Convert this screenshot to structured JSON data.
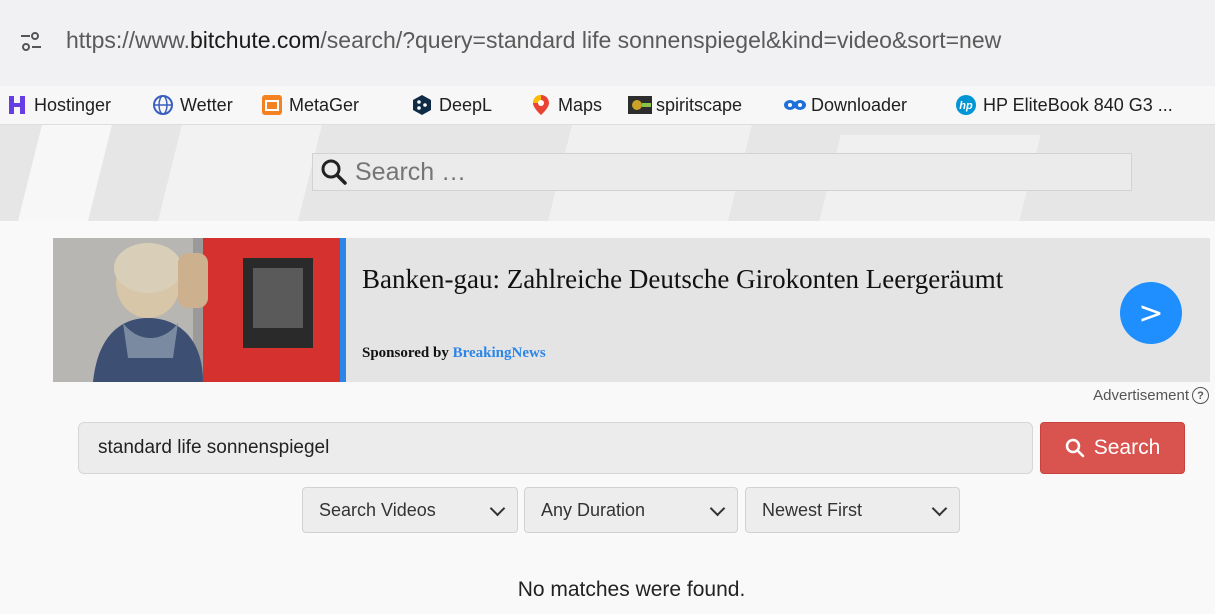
{
  "browser": {
    "url_prefix": "https://www.",
    "url_domain": "bitchute.com",
    "url_rest": "/search/?query=standard life sonnenspiegel&kind=video&sort=new"
  },
  "bookmarks": [
    {
      "label": "Hostinger",
      "icon": "hostinger-icon",
      "color": "#673de6"
    },
    {
      "label": "Wetter",
      "icon": "globe-icon",
      "color": "#3b5fc0"
    },
    {
      "label": "MetaGer",
      "icon": "metager-icon",
      "color": "#f58220"
    },
    {
      "label": "DeepL",
      "icon": "deepl-icon",
      "color": "#0f2b46"
    },
    {
      "label": "Maps",
      "icon": "map-pin-icon",
      "color": "#34a853"
    },
    {
      "label": "spiritscape",
      "icon": "spiritscape-icon",
      "color": "#c9a227"
    },
    {
      "label": "Downloader",
      "icon": "downloader-icon",
      "color": "#1e6fd9"
    },
    {
      "label": "HP EliteBook 840 G3 ...",
      "icon": "hp-icon",
      "color": "#0096d6"
    }
  ],
  "header": {
    "search_placeholder": "Search …"
  },
  "ad": {
    "title": "Banken-gau: Zahlreiche Deutsche Girokonten Leergeräumt",
    "sponsored_prefix": "Sponsored by ",
    "sponsor": "BreakingNews",
    "arrow": ">",
    "label": "Advertisement",
    "help": "?"
  },
  "search": {
    "query": "standard life sonnenspiegel",
    "button_label": "Search",
    "kind_selected": "Search Videos",
    "duration_selected": "Any Duration",
    "sort_selected": "Newest First"
  },
  "results": {
    "message": "No matches were found."
  },
  "colors": {
    "search_button": "#d9534f",
    "ad_accent": "#2b86e8",
    "ad_arrow": "#1f8fff"
  }
}
